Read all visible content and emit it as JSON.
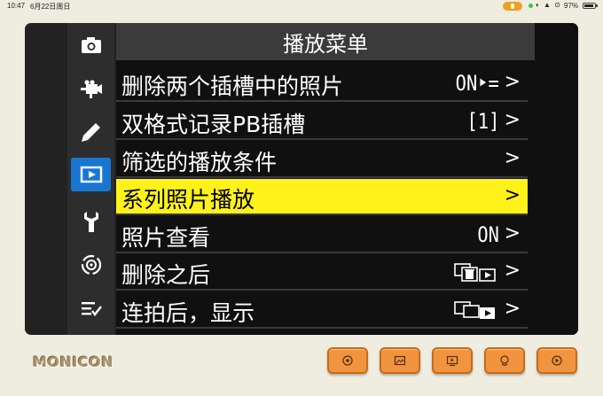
{
  "status_bar": {
    "time": "10:47",
    "date": "6月22日周日",
    "battery_pct": "97%",
    "icons": "◐ ▲ ⊙"
  },
  "sidebar": {
    "items": [
      {
        "icon": "camera-icon",
        "active": false
      },
      {
        "icon": "video-camera-icon",
        "active": false
      },
      {
        "icon": "pencil-icon",
        "active": false
      },
      {
        "icon": "playback-icon",
        "active": true
      },
      {
        "icon": "wrench-icon",
        "active": false
      },
      {
        "icon": "network-icon",
        "active": false
      },
      {
        "icon": "my-menu-icon",
        "active": false
      }
    ]
  },
  "menu": {
    "title": "播放菜单",
    "items": [
      {
        "label": "删除两个插槽中的照片",
        "value": "ON‣=",
        "arrow": ">"
      },
      {
        "label": "双格式记录PB插槽",
        "value": "[1]",
        "arrow": ">"
      },
      {
        "label": "筛选的播放条件",
        "value": "",
        "arrow": ">"
      },
      {
        "label": "系列照片播放",
        "value": "",
        "arrow": ">",
        "selected": true
      },
      {
        "label": "照片查看",
        "value": "ON",
        "arrow": ">"
      },
      {
        "label": "删除之后",
        "value_icon": "delete-then-next-icon",
        "arrow": ">"
      },
      {
        "label": "连拍后，显示",
        "value_icon": "next-frame-icon",
        "arrow": ">"
      }
    ]
  },
  "brand": {
    "name": "MONICON"
  },
  "buttons": [
    {
      "icon": "record-icon"
    },
    {
      "icon": "image-icon"
    },
    {
      "icon": "screen-icon"
    },
    {
      "icon": "palette-icon"
    },
    {
      "icon": "play-circle-icon"
    }
  ],
  "colors": {
    "highlight": "#fff21a",
    "active_tab": "#1a77d0",
    "button": "#f09440"
  }
}
